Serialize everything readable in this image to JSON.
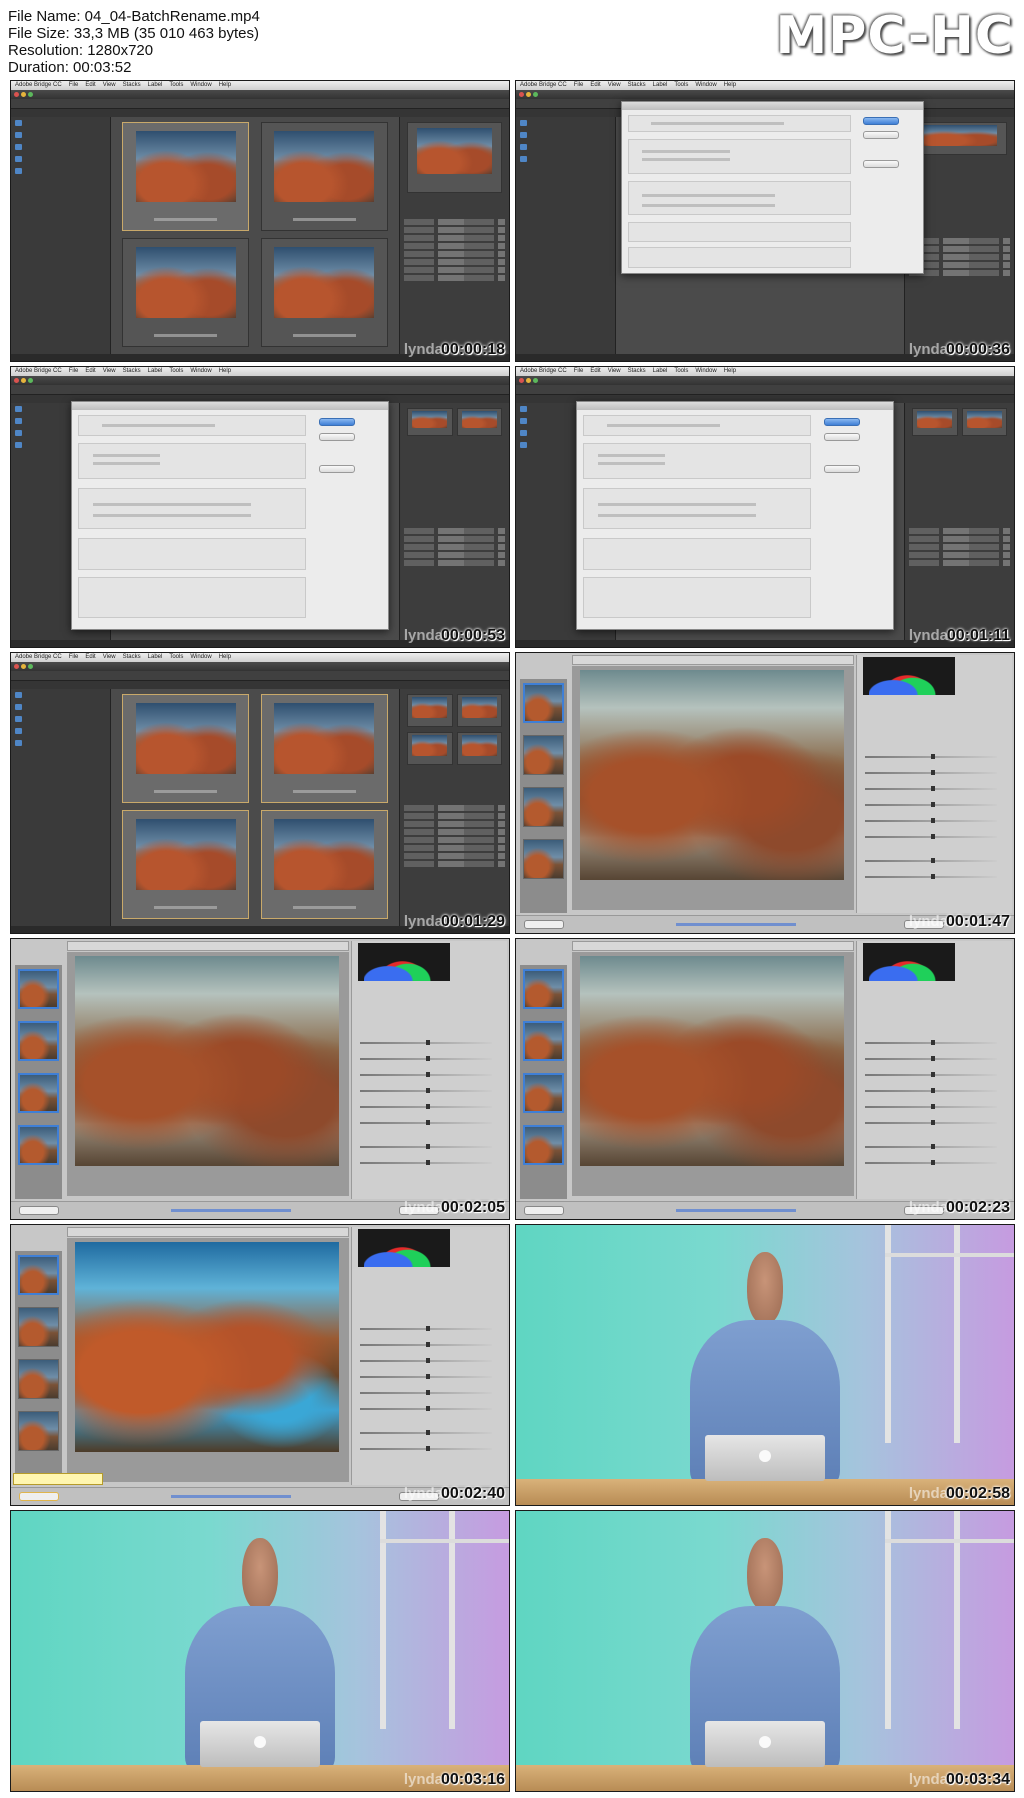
{
  "header": {
    "file_name": "File Name: 04_04-BatchRename.mp4",
    "file_size": "File Size: 33,3 MB (35 010 463 bytes)",
    "resolution": "Resolution: 1280x720",
    "duration": "Duration: 00:03:52",
    "brand": "MPC-HC"
  },
  "watermark": "lynda",
  "bridge": {
    "menu": [
      "Adobe Bridge CC",
      "File",
      "Edit",
      "View",
      "Stacks",
      "Label",
      "Tools",
      "Window",
      "Help"
    ]
  },
  "frames": [
    {
      "timestamp": "00:00:18",
      "kind": "bridge-grid"
    },
    {
      "timestamp": "00:00:36",
      "kind": "bridge-dialog"
    },
    {
      "timestamp": "00:00:53",
      "kind": "bridge-dialog"
    },
    {
      "timestamp": "00:01:11",
      "kind": "bridge-dialog"
    },
    {
      "timestamp": "00:01:29",
      "kind": "bridge-grid"
    },
    {
      "timestamp": "00:01:47",
      "kind": "camera-raw"
    },
    {
      "timestamp": "00:02:05",
      "kind": "camera-raw"
    },
    {
      "timestamp": "00:02:23",
      "kind": "camera-raw"
    },
    {
      "timestamp": "00:02:40",
      "kind": "camera-raw-vivid"
    },
    {
      "timestamp": "00:02:58",
      "kind": "presenter"
    },
    {
      "timestamp": "00:03:16",
      "kind": "presenter"
    },
    {
      "timestamp": "00:03:34",
      "kind": "presenter"
    }
  ]
}
